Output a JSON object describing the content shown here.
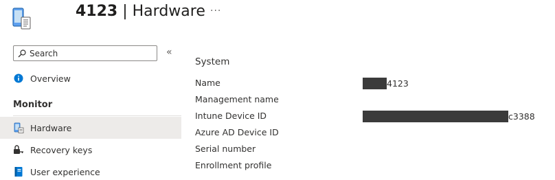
{
  "header": {
    "device_name": "4123",
    "separator": " | ",
    "title": "Hardware",
    "more_label": "···",
    "device_icon": "mobile-device-icon"
  },
  "sidebar": {
    "search": {
      "placeholder": "Search",
      "icon": "search-icon"
    },
    "collapse_label": "«",
    "items": [
      {
        "label": "Overview",
        "icon": "info-icon"
      }
    ],
    "sections": [
      {
        "header": "Monitor",
        "items": [
          {
            "label": "Hardware",
            "icon": "hardware-icon",
            "selected": true
          },
          {
            "label": "Recovery keys",
            "icon": "key-icon",
            "selected": false
          },
          {
            "label": "User experience",
            "icon": "book-icon",
            "selected": false
          }
        ]
      }
    ]
  },
  "main": {
    "group_title": "System",
    "properties": [
      {
        "label": "Name",
        "value": "4123",
        "redacted_prefix": true
      },
      {
        "label": "Management name",
        "value": ""
      },
      {
        "label": "Intune Device ID",
        "value": "c3388",
        "redacted_prefix": true
      },
      {
        "label": "Azure AD Device ID",
        "value": ""
      },
      {
        "label": "Serial number",
        "value": ""
      },
      {
        "label": "Enrollment profile",
        "value": ""
      }
    ]
  },
  "colors": {
    "accent": "#0078d4",
    "selected_background": "#edebe9",
    "redaction": "#3b3b3b"
  }
}
